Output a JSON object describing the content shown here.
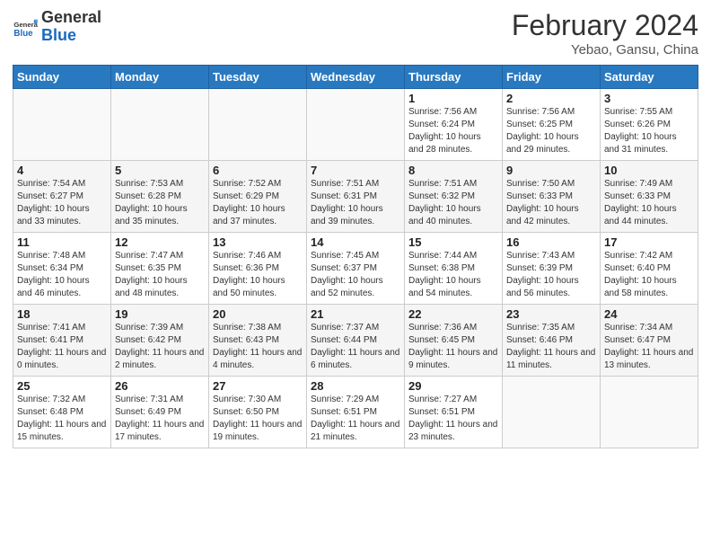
{
  "header": {
    "logo_general": "General",
    "logo_blue": "Blue",
    "month_title": "February 2024",
    "location": "Yebao, Gansu, China"
  },
  "days_of_week": [
    "Sunday",
    "Monday",
    "Tuesday",
    "Wednesday",
    "Thursday",
    "Friday",
    "Saturday"
  ],
  "weeks": [
    [
      null,
      null,
      null,
      null,
      {
        "day": "1",
        "sunrise": "7:56 AM",
        "sunset": "6:24 PM",
        "daylight": "10 hours and 28 minutes."
      },
      {
        "day": "2",
        "sunrise": "7:56 AM",
        "sunset": "6:25 PM",
        "daylight": "10 hours and 29 minutes."
      },
      {
        "day": "3",
        "sunrise": "7:55 AM",
        "sunset": "6:26 PM",
        "daylight": "10 hours and 31 minutes."
      }
    ],
    [
      {
        "day": "4",
        "sunrise": "7:54 AM",
        "sunset": "6:27 PM",
        "daylight": "10 hours and 33 minutes."
      },
      {
        "day": "5",
        "sunrise": "7:53 AM",
        "sunset": "6:28 PM",
        "daylight": "10 hours and 35 minutes."
      },
      {
        "day": "6",
        "sunrise": "7:52 AM",
        "sunset": "6:29 PM",
        "daylight": "10 hours and 37 minutes."
      },
      {
        "day": "7",
        "sunrise": "7:51 AM",
        "sunset": "6:31 PM",
        "daylight": "10 hours and 39 minutes."
      },
      {
        "day": "8",
        "sunrise": "7:51 AM",
        "sunset": "6:32 PM",
        "daylight": "10 hours and 40 minutes."
      },
      {
        "day": "9",
        "sunrise": "7:50 AM",
        "sunset": "6:33 PM",
        "daylight": "10 hours and 42 minutes."
      },
      {
        "day": "10",
        "sunrise": "7:49 AM",
        "sunset": "6:33 PM",
        "daylight": "10 hours and 44 minutes."
      }
    ],
    [
      {
        "day": "11",
        "sunrise": "7:48 AM",
        "sunset": "6:34 PM",
        "daylight": "10 hours and 46 minutes."
      },
      {
        "day": "12",
        "sunrise": "7:47 AM",
        "sunset": "6:35 PM",
        "daylight": "10 hours and 48 minutes."
      },
      {
        "day": "13",
        "sunrise": "7:46 AM",
        "sunset": "6:36 PM",
        "daylight": "10 hours and 50 minutes."
      },
      {
        "day": "14",
        "sunrise": "7:45 AM",
        "sunset": "6:37 PM",
        "daylight": "10 hours and 52 minutes."
      },
      {
        "day": "15",
        "sunrise": "7:44 AM",
        "sunset": "6:38 PM",
        "daylight": "10 hours and 54 minutes."
      },
      {
        "day": "16",
        "sunrise": "7:43 AM",
        "sunset": "6:39 PM",
        "daylight": "10 hours and 56 minutes."
      },
      {
        "day": "17",
        "sunrise": "7:42 AM",
        "sunset": "6:40 PM",
        "daylight": "10 hours and 58 minutes."
      }
    ],
    [
      {
        "day": "18",
        "sunrise": "7:41 AM",
        "sunset": "6:41 PM",
        "daylight": "11 hours and 0 minutes."
      },
      {
        "day": "19",
        "sunrise": "7:39 AM",
        "sunset": "6:42 PM",
        "daylight": "11 hours and 2 minutes."
      },
      {
        "day": "20",
        "sunrise": "7:38 AM",
        "sunset": "6:43 PM",
        "daylight": "11 hours and 4 minutes."
      },
      {
        "day": "21",
        "sunrise": "7:37 AM",
        "sunset": "6:44 PM",
        "daylight": "11 hours and 6 minutes."
      },
      {
        "day": "22",
        "sunrise": "7:36 AM",
        "sunset": "6:45 PM",
        "daylight": "11 hours and 9 minutes."
      },
      {
        "day": "23",
        "sunrise": "7:35 AM",
        "sunset": "6:46 PM",
        "daylight": "11 hours and 11 minutes."
      },
      {
        "day": "24",
        "sunrise": "7:34 AM",
        "sunset": "6:47 PM",
        "daylight": "11 hours and 13 minutes."
      }
    ],
    [
      {
        "day": "25",
        "sunrise": "7:32 AM",
        "sunset": "6:48 PM",
        "daylight": "11 hours and 15 minutes."
      },
      {
        "day": "26",
        "sunrise": "7:31 AM",
        "sunset": "6:49 PM",
        "daylight": "11 hours and 17 minutes."
      },
      {
        "day": "27",
        "sunrise": "7:30 AM",
        "sunset": "6:50 PM",
        "daylight": "11 hours and 19 minutes."
      },
      {
        "day": "28",
        "sunrise": "7:29 AM",
        "sunset": "6:51 PM",
        "daylight": "11 hours and 21 minutes."
      },
      {
        "day": "29",
        "sunrise": "7:27 AM",
        "sunset": "6:51 PM",
        "daylight": "11 hours and 23 minutes."
      },
      null,
      null
    ]
  ]
}
